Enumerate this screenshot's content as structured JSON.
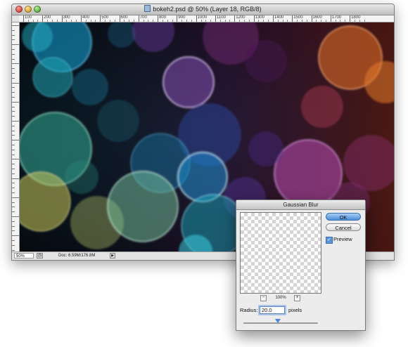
{
  "document_window": {
    "title": "bokeh2.psd @ 50% (Layer 18, RGB/8)",
    "ruler_top_labels": [
      "100",
      "200",
      "300",
      "400",
      "500",
      "600",
      "700",
      "800",
      "900",
      "1000",
      "1100",
      "1200",
      "1300",
      "1400",
      "1500",
      "1600",
      "1700",
      "1800"
    ],
    "status": {
      "zoom": "50%",
      "doc_info": "Doc: 6.59M/176.8M"
    }
  },
  "dialog": {
    "title": "Gaussian Blur",
    "ok_label": "OK",
    "cancel_label": "Cancel",
    "preview_label": "Preview",
    "preview_checked": true,
    "zoom_percent": "100%",
    "zoom_out_symbol": "−",
    "zoom_in_symbol": "+",
    "radius_label": "Radius:",
    "radius_value": "20.0",
    "units_label": "pixels",
    "slider_value_fraction": 0.46
  },
  "colors": {
    "ok_button": "#4d8fdb",
    "canvas_background": "#0a1018"
  },
  "icons": {
    "close": "close-icon",
    "minimize": "minimize-icon",
    "zoom": "zoom-icon",
    "file": "psd-file-icon"
  }
}
